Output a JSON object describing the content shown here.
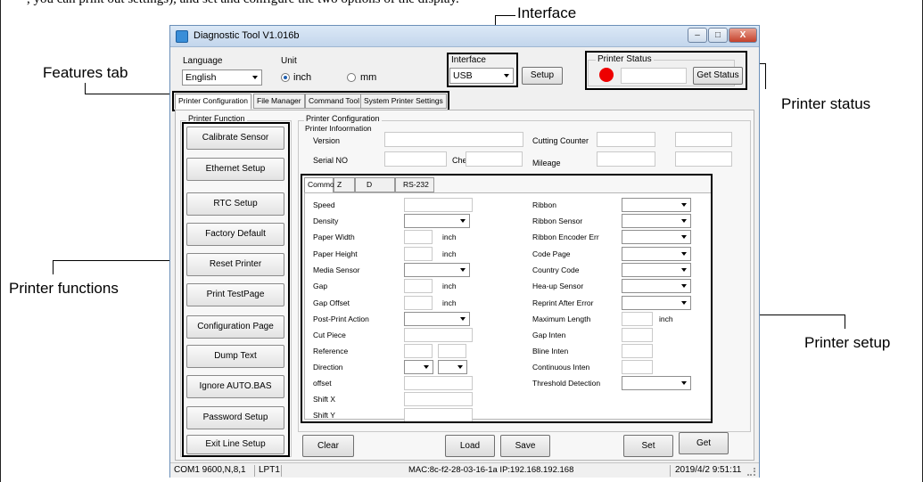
{
  "intro_text": ", you can print out settings), and set and configure the two options of the display.",
  "callouts": {
    "interface": "Interface",
    "features_tab": "Features tab",
    "printer_status": "Printer status",
    "printer_functions": "Printer functions",
    "printer_setup": "Printer setup"
  },
  "window": {
    "title": "Diagnostic Tool V1.016b",
    "minimize_label": "–",
    "maximize_label": "□",
    "close_label": "X"
  },
  "top": {
    "language_label": "Language",
    "language_value": "English",
    "unit_label": "Unit",
    "unit_options": [
      "inch",
      "mm"
    ],
    "unit_selected": "inch",
    "interface_label": "Interface",
    "interface_value": "USB",
    "setup_button": "Setup",
    "printer_status_label": "Printer  Status",
    "status_color": "#ee0000",
    "get_status_button": "Get Status"
  },
  "tabs": [
    "Printer Configuration",
    "File Manager",
    "Command Tool",
    "System Printer Settings"
  ],
  "printer_function": {
    "group_label": "Printer  Function",
    "buttons": [
      "Calibrate Sensor",
      "Ethernet Setup",
      "RTC Setup",
      "Factory Default",
      "Reset Printer",
      "Print TestPage",
      "Configuration Page",
      "Dump Text",
      "Ignore AUTO.BAS",
      "Password Setup",
      "Exit Line Setup"
    ]
  },
  "configuration": {
    "group_label": "Printer Configuration",
    "info_label": "Printer Infoormation",
    "version_label": "Version",
    "cutting_counter_label": "Cutting Counter",
    "serial_label": "Serial NO",
    "checksum_label": "Check Sum",
    "mileage_label": "Mileage",
    "subtabs": [
      "Common",
      "Z",
      "D",
      "RS-232"
    ],
    "left_fields": [
      "Speed",
      "Density",
      "Paper Width",
      "Paper Height",
      "Media Sensor",
      "Gap",
      "Gap Offset",
      "Post-Print  Action",
      "Cut  Piece",
      "Reference",
      "Direction",
      "offset",
      "Shift X",
      "Shift Y"
    ],
    "unit_inch": "inch",
    "right_fields": [
      "Ribbon",
      "Ribbon  Sensor",
      "Ribbon Encoder Err",
      "Code Page",
      "Country Code",
      "Hea-up  Sensor",
      "Reprint After  Error",
      "Maximum Length",
      "Gap Inten",
      "Bline  Inten",
      "Continuous  Inten",
      "Threshold  Detection"
    ]
  },
  "bottom_buttons": [
    "Clear",
    "Load",
    "Save",
    "Set",
    "Get"
  ],
  "statusbar": {
    "port": "COM1 9600,N,8,1",
    "lpt": "LPT1",
    "network": "MAC:8c-f2-28-03-16-1a   IP:192.168.192.168",
    "datetime": "2019/4/2 9:51:11"
  }
}
